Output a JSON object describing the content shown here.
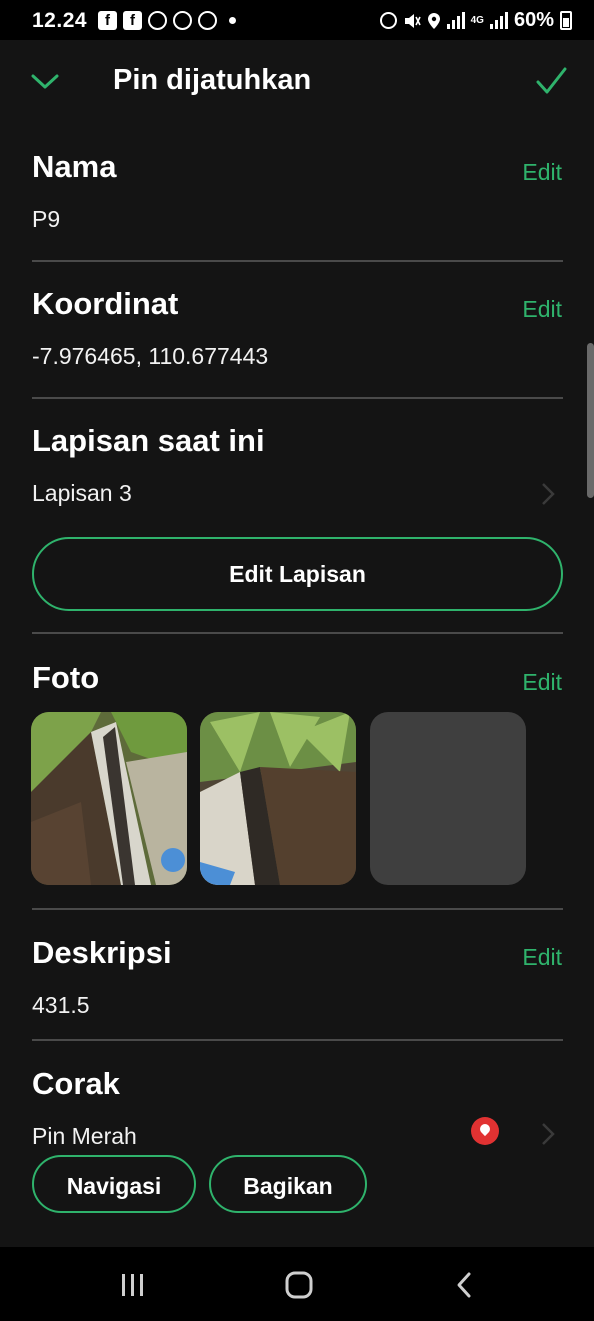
{
  "status_bar": {
    "time": "12.24",
    "battery": "60%",
    "network": "4G",
    "icons_left": [
      "facebook-icon",
      "facebook-icon",
      "whatsapp-icon",
      "app-icon",
      "app-icon",
      "dot-icon"
    ],
    "icons_right": [
      "alarm-icon",
      "mute-icon",
      "location-icon",
      "signal-icon",
      "signal-4g-icon",
      "battery-icon"
    ]
  },
  "header": {
    "title": "Pin dijatuhkan",
    "collapse_icon": "chevron-down-icon",
    "confirm_icon": "check-icon"
  },
  "sections": {
    "name": {
      "label": "Nama",
      "value": "P9",
      "edit": "Edit"
    },
    "coordinate": {
      "label": "Koordinat",
      "value": "-7.976465, 110.677443",
      "edit": "Edit"
    },
    "layer": {
      "label": "Lapisan saat ini",
      "value": "Lapisan 3",
      "button": "Edit Lapisan"
    },
    "photo": {
      "label": "Foto",
      "edit": "Edit"
    },
    "description": {
      "label": "Deskripsi",
      "value": "431.5",
      "edit": "Edit"
    },
    "style": {
      "label": "Corak",
      "value": "Pin Merah",
      "pin_color": "#e13232"
    }
  },
  "actions": {
    "navigate": "Navigasi",
    "share": "Bagikan"
  },
  "nav": [
    "recent-apps-icon",
    "home-icon",
    "back-icon"
  ],
  "colors": {
    "accent": "#2fb36c",
    "background": "#141414"
  }
}
